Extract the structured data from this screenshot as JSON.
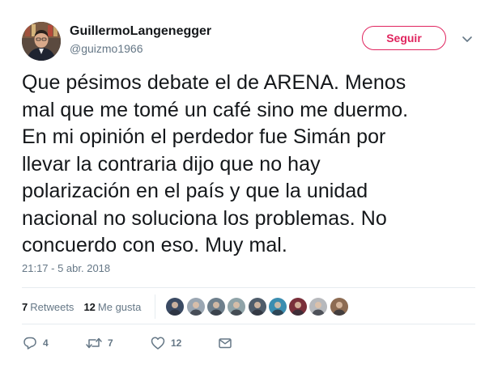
{
  "user": {
    "name": "GuillermoLangenegger",
    "handle": "@guizmo1966"
  },
  "follow_button": {
    "label": "Seguir"
  },
  "tweet": {
    "lines": [
      "Que pésimos debate el de ARENA. Menos",
      "mal que me tomé un café sino me duermo.",
      "En mi opinión el perdedor fue Simán por",
      "llevar la contraria dijo que no hay",
      "polarización en el país y que la unidad",
      "nacional no soluciona los problemas. No",
      "concuerdo con eso. Muy mal."
    ],
    "timestamp": "21:17 - 5 abr. 2018"
  },
  "stats": {
    "retweets_count": "7",
    "retweets_label": "Retweets",
    "likes_count": "12",
    "likes_label": "Me gusta"
  },
  "likers": [
    {
      "icon": "user-avatar",
      "color": "#3a4a63"
    },
    {
      "icon": "user-avatar",
      "color": "#9aa6b2"
    },
    {
      "icon": "user-avatar",
      "color": "#6e7f8c"
    },
    {
      "icon": "user-avatar",
      "color": "#8fa3a8"
    },
    {
      "icon": "user-avatar",
      "color": "#4f5d6b"
    },
    {
      "icon": "user-avatar",
      "color": "#3b8db0"
    },
    {
      "icon": "user-avatar",
      "color": "#7a2f3a"
    },
    {
      "icon": "user-avatar",
      "color": "#b7b9bd"
    },
    {
      "icon": "user-avatar",
      "color": "#8d6b52"
    }
  ],
  "actions": {
    "reply_count": "4",
    "retweet_count": "7",
    "like_count": "12"
  },
  "colors": {
    "accent": "#e0245e",
    "muted": "#657786",
    "text": "#14171a",
    "divider": "#e6ecf0"
  }
}
